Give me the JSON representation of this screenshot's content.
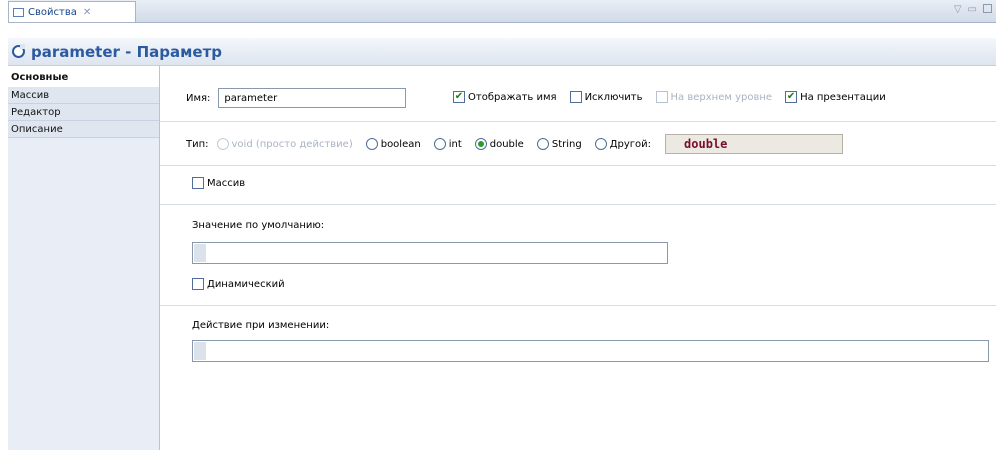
{
  "view_tab": {
    "label": "Свойства",
    "close_glyph": "✕"
  },
  "view_controls": {
    "minimize_glyph": "▽",
    "restore_glyph": "▭"
  },
  "header": {
    "title": "parameter - Параметр",
    "icon": "parameter-icon"
  },
  "sidebar": {
    "items": [
      {
        "label": "Основные",
        "active": true
      },
      {
        "label": "Массив",
        "active": false
      },
      {
        "label": "Редактор",
        "active": false
      },
      {
        "label": "Описание",
        "active": false
      }
    ]
  },
  "main": {
    "name_label": "Имя:",
    "name_value": "parameter",
    "show_name": {
      "label": "Отображать имя",
      "checked": true
    },
    "exclude": {
      "label": "Исключить",
      "checked": false
    },
    "top_level": {
      "label": "На верхнем уровне",
      "checked": false,
      "enabled": false
    },
    "on_presentation": {
      "label": "На презентации",
      "checked": true
    },
    "type_label": "Тип:",
    "type_options": [
      {
        "label": "void (просто действие)",
        "selected": false,
        "enabled": false
      },
      {
        "label": "boolean",
        "selected": false,
        "enabled": true
      },
      {
        "label": "int",
        "selected": false,
        "enabled": true
      },
      {
        "label": "double",
        "selected": true,
        "enabled": true
      },
      {
        "label": "String",
        "selected": false,
        "enabled": true
      },
      {
        "label": "Другой:",
        "selected": false,
        "enabled": true
      }
    ],
    "other_type_value": "double",
    "array": {
      "label": "Массив",
      "checked": false
    },
    "default_value_label": "Значение по умолчанию:",
    "default_value": "",
    "dynamic": {
      "label": "Динамический",
      "checked": false
    },
    "on_change_label": "Действие при изменении:",
    "on_change_value": ""
  },
  "colors": {
    "accent": "#2c5aa0",
    "selected_radio": "#2a9b2a",
    "code_text": "#7a0d2c"
  }
}
